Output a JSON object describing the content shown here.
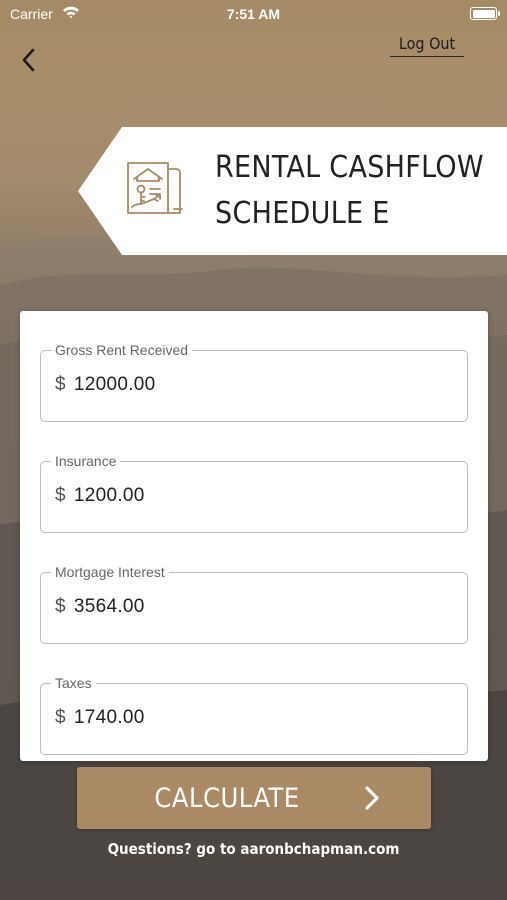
{
  "status_bar": {
    "carrier": "Carrier",
    "time": "7:51 AM"
  },
  "nav": {
    "back_icon": "chevron-left-icon",
    "logout_label": "Log Out"
  },
  "banner": {
    "icon": "house-document-icon",
    "title_line1": "RENTAL CASHFLOW",
    "title_line2": "SCHEDULE E"
  },
  "form": {
    "fields": [
      {
        "label": "Gross Rent Received",
        "currency": "$",
        "value": "12000.00"
      },
      {
        "label": "Insurance",
        "currency": "$",
        "value": "1200.00"
      },
      {
        "label": "Mortgage Interest",
        "currency": "$",
        "value": "3564.00"
      },
      {
        "label": "Taxes",
        "currency": "$",
        "value": "1740.00"
      }
    ]
  },
  "calculate": {
    "label": "CALCULATE",
    "icon": "chevron-right-icon"
  },
  "footer": {
    "text": "Questions? go to aaronbchapman.com"
  },
  "colors": {
    "accent": "#a98a65",
    "banner_bg": "#ffffff",
    "card_bg": "#ffffff"
  }
}
